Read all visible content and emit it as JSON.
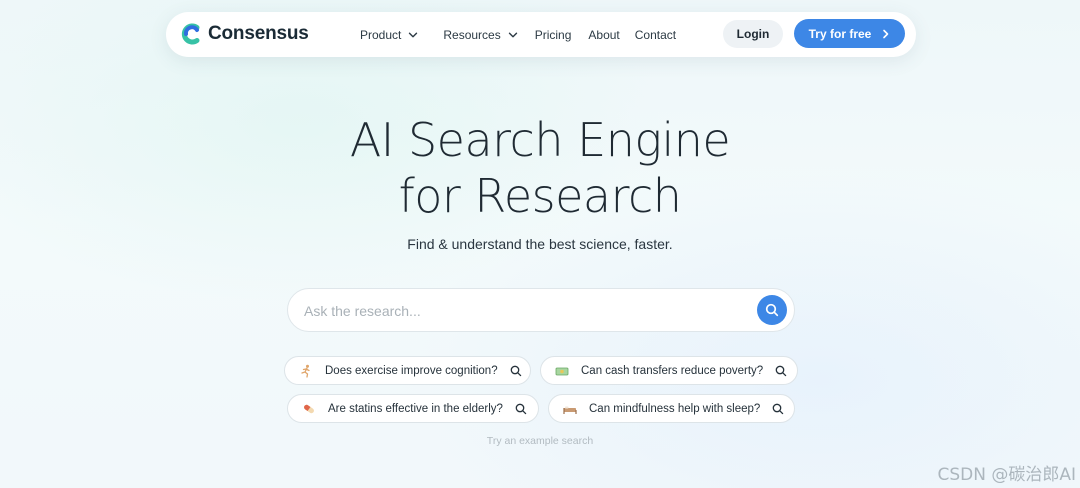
{
  "nav": {
    "brand": "Consensus",
    "menu": [
      {
        "label": "Product",
        "has_dropdown": true
      },
      {
        "label": "Resources",
        "has_dropdown": true
      },
      {
        "label": "Pricing",
        "has_dropdown": false
      },
      {
        "label": "About",
        "has_dropdown": false
      },
      {
        "label": "Contact",
        "has_dropdown": false
      }
    ],
    "login_label": "Login",
    "try_label": "Try for free"
  },
  "hero": {
    "title_line1": "AI Search Engine",
    "title_line2": "for Research",
    "subtitle": "Find & understand the best science, faster."
  },
  "search": {
    "placeholder": "Ask the research...",
    "value": ""
  },
  "examples": [
    {
      "icon": "running-person-icon",
      "label": "Does exercise improve cognition?"
    },
    {
      "icon": "money-icon",
      "label": "Can cash transfers reduce poverty?"
    },
    {
      "icon": "pill-icon",
      "label": "Are statins effective in the elderly?"
    },
    {
      "icon": "bed-icon",
      "label": "Can mindfulness help with sleep?"
    }
  ],
  "hint": "Try an example search",
  "watermark": "CSDN @碳治郎AI",
  "colors": {
    "accent": "#3d87e6",
    "logo_teal": "#37c2a6",
    "logo_blue": "#2f6ee0",
    "text": "#1f2a33"
  }
}
